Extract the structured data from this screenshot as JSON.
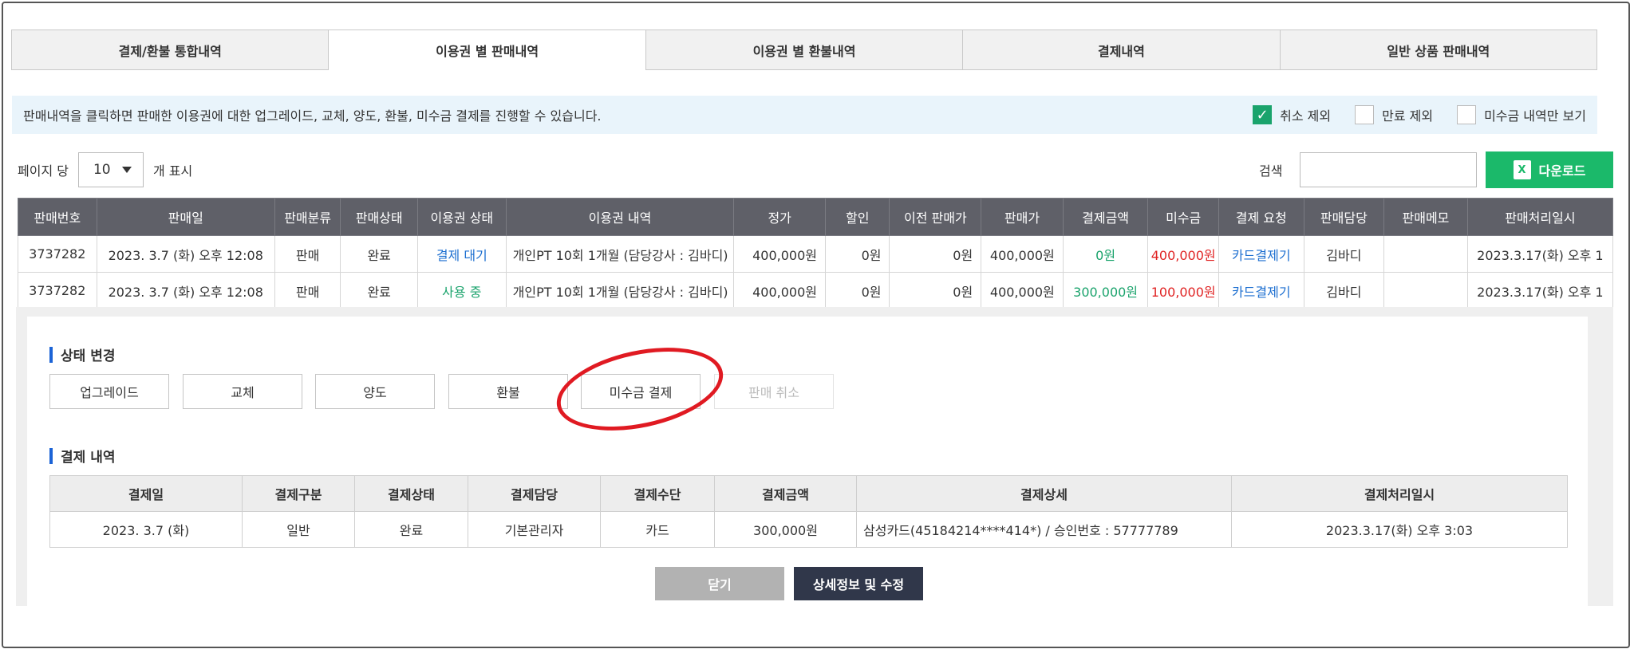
{
  "tabs": [
    "결제/환불 통합내역",
    "이용권 별 판매내역",
    "이용권 별 환불내역",
    "결제내역",
    "일반 상품 판매내역"
  ],
  "active_tab": 1,
  "info": {
    "message": "판매내역을 클릭하면 판매한 이용권에 대한 업그레이드, 교체, 양도, 환불, 미수금 결제를 진행할 수 있습니다.",
    "filters": [
      {
        "label": "취소 제외",
        "checked": true
      },
      {
        "label": "만료 제외",
        "checked": false
      },
      {
        "label": "미수금 내역만 보기",
        "checked": false
      }
    ]
  },
  "page_size": {
    "prefix": "페이지 당",
    "value": "10",
    "suffix": "개 표시"
  },
  "search": {
    "label": "검색",
    "value": ""
  },
  "download": {
    "label": "다운로드",
    "icon_text": "X"
  },
  "sales_table": {
    "columns": [
      "판매번호",
      "판매일",
      "판매분류",
      "판매상태",
      "이용권 상태",
      "이용권 내역",
      "정가",
      "할인",
      "이전 판매가",
      "판매가",
      "결제금액",
      "미수금",
      "결제 요청",
      "판매담당",
      "판매메모",
      "판매처리일시"
    ],
    "rows": [
      [
        "3737282",
        "2023. 3.7 (화) 오후 12:08",
        "판매",
        "완료",
        "결제 대기",
        "개인PT 10회 1개월 (담당강사 : 김바디)",
        "400,000원",
        "0원",
        "0원",
        "400,000원",
        "0원",
        "400,000원",
        "카드결제기",
        "김바디",
        "",
        "2023.3.17(화) 오후 1"
      ],
      [
        "3737282",
        "2023. 3.7 (화) 오후 12:08",
        "판매",
        "완료",
        "사용 중",
        "개인PT 10회 1개월 (담당강사 : 김바디)",
        "400,000원",
        "0원",
        "0원",
        "400,000원",
        "300,000원",
        "100,000원",
        "카드결제기",
        "김바디",
        "",
        "2023.3.17(화) 오후 1"
      ]
    ]
  },
  "status_change": {
    "title": "상태 변경",
    "actions": [
      "업그레이드",
      "교체",
      "양도",
      "환불",
      "미수금 결제",
      "판매 취소"
    ]
  },
  "payment": {
    "title": "결제 내역",
    "columns": [
      "결제일",
      "결제구분",
      "결제상태",
      "결제담당",
      "결제수단",
      "결제금액",
      "결제상세",
      "결제처리일시"
    ],
    "rows": [
      [
        "2023. 3.7 (화)",
        "일반",
        "완료",
        "기본관리자",
        "카드",
        "300,000원",
        "삼성카드(45184214****414*) / 승인번호 : 57777789",
        "2023.3.17(화) 오후 3:03"
      ]
    ]
  },
  "buttons": {
    "close": "닫기",
    "edit": "상세정보 및 수정"
  },
  "colors": {
    "accent_green": "#1bb96a",
    "header_gray": "#5f6068",
    "highlight_red": "#e01a22",
    "dark_button": "#30374a"
  }
}
